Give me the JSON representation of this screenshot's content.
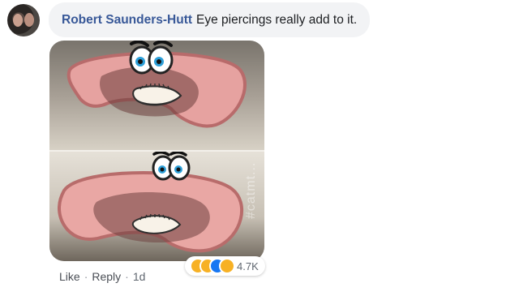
{
  "comment": {
    "author": "Robert Saunders-Hutt",
    "text": "Eye piercings really add to it."
  },
  "photo": {
    "watermark": "#catmt..."
  },
  "actions": {
    "like": "Like",
    "reply": "Reply",
    "time": "1d",
    "separator": "·"
  },
  "reactions": {
    "count": "4.7K",
    "types": [
      "haha-icon",
      "wow-icon",
      "like-icon",
      "sad-icon"
    ]
  }
}
